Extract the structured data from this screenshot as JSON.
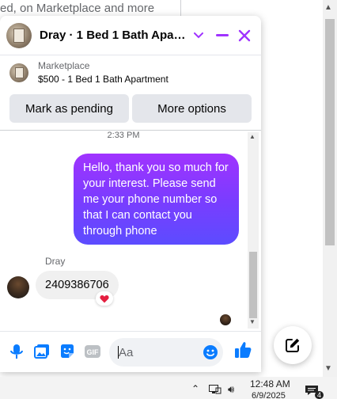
{
  "background": {
    "text": "ed, on Marketplace and more"
  },
  "chat": {
    "title": "Dray · 1 Bed 1 Bath Apartm...",
    "listing": {
      "source": "Marketplace",
      "name": "$500 - 1 Bed 1 Bath Apartment"
    },
    "actions": {
      "pending_label": "Mark as pending",
      "more_label": "More options"
    },
    "timestamp": "2:33 PM",
    "messages": [
      {
        "from": "me",
        "text": "Hello, thank you so much for your interest. Please send me your phone number so that I can contact you through phone"
      },
      {
        "from": "Dray",
        "sender_name": "Dray",
        "text": "2409386706",
        "reaction": "❤️"
      }
    ],
    "composer": {
      "placeholder": "Aa"
    }
  },
  "taskbar": {
    "time": "12:48 AM",
    "date": "6/9/2025",
    "notification_count": "4"
  },
  "colors": {
    "accent": "#a033ff",
    "bubble_gradient_end": "#5c4cff",
    "composer_icon_blue": "#0a7cff"
  },
  "icons": {
    "mic": "microphone-icon",
    "photo": "photo-icon",
    "sticker": "sticker-icon",
    "gif": "gif-icon",
    "emoji": "emoji-icon",
    "like": "thumbs-up-icon",
    "new_message": "new-message-icon"
  }
}
